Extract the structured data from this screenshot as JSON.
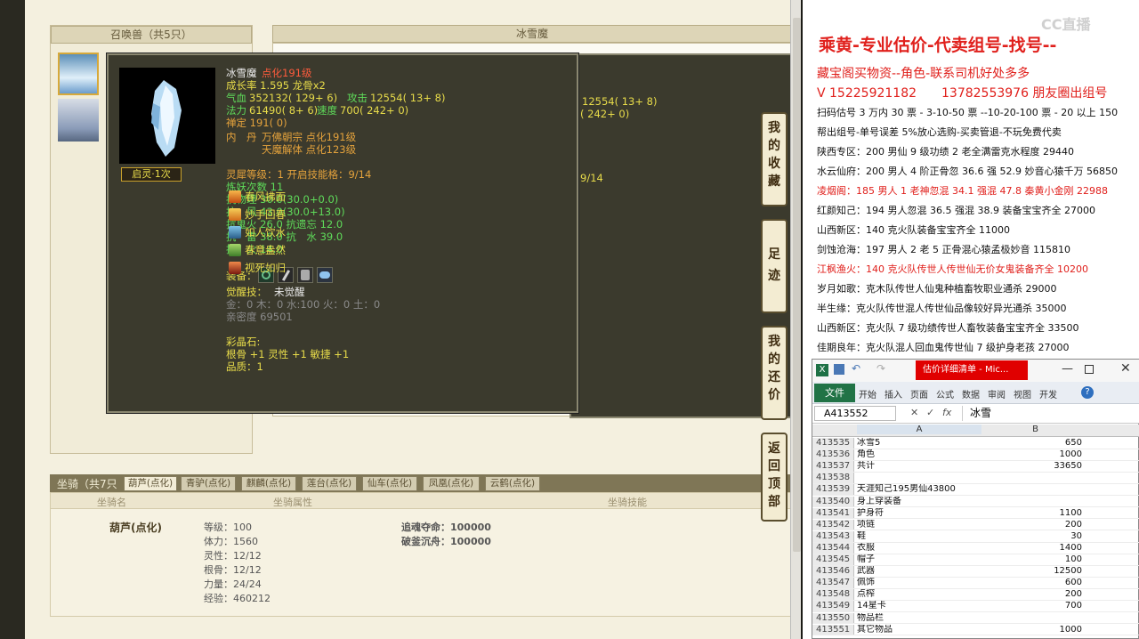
{
  "game": {
    "summon_header": "召唤兽（共5只）",
    "pet_name_header": "冰雪魔",
    "mount_header": "坐骑（共7只",
    "mount_tabs": [
      "葫芦(点化)",
      "青驴(点化)",
      "麒麟(点化)",
      "莲台(点化)",
      "仙车(点化)",
      "凤凰(点化)",
      "云鹤(点化)"
    ],
    "mount_cols": [
      "坐骑名",
      "坐骑属性",
      "坐骑技能"
    ],
    "mount_name": "葫芦(点化)",
    "mount_attrs": [
      "等级：100",
      "体力：1560",
      "灵性：12/12",
      "根骨：12/12",
      "力量：24/24",
      "经验：460212"
    ],
    "mount_skills": [
      "追魂夺命：100000",
      "破釜沉舟：100000"
    ],
    "side_buttons": [
      "我的收藏",
      "足迹",
      "我的还价",
      "返回顶部"
    ],
    "bg_peek": {
      "l1": "12554( 13+ 8)",
      "l2": "( 242+ 0)",
      "l3": "9/14"
    },
    "popup": {
      "name": "冰雪魔",
      "name_suffix": "点化191级",
      "growth": "成长率 1.595 龙骨x2",
      "hp_label": "气血",
      "hp_val": "352132( 129+ 6)",
      "atk_label": "攻击",
      "atk_val": "12554( 13+ 8)",
      "mp_label": "法力",
      "mp_val": "61490( 8+ 6)",
      "spd_label": "速度",
      "spd_val": "700( 242+ 0)",
      "zen": "禅定 191( 0)",
      "inner_label": "内　丹",
      "inner1": "万佛朝宗 点化191级",
      "inner2": "天魔解体 点化123级",
      "awaken_label": "启灵·1次",
      "skills": [
        "春风拂面",
        "妙手回春",
        "如人饮水",
        "春意盎然",
        "视死如归"
      ],
      "spirit": "灵犀等级：1 开启技能格：9/14",
      "refine": "炼妖次数 11",
      "res_phys": "抗物理 30.0(30.0+0.0)",
      "res_wind": "抗　风 43.0(30.0+13.0)",
      "res_ghost": "抗鬼火 26.0 抗遗忘 12.0",
      "res_thunder": "抗　雷 38.0 抗　水 39.0",
      "res_fire": "抗　火 14.0",
      "equip_label": "装备：",
      "awake_skill_label": "觉醒技：",
      "awake_skill_val": "未觉醒",
      "elements": "金：0 木：0 水:100 火：0 土：0",
      "intimacy": "亲密度 69501",
      "gem_label": "彩晶石:",
      "gem_vals": "根骨 +1 灵性 +1 敏捷 +1",
      "quality": "品质：1"
    }
  },
  "right": {
    "title": "乘黄-专业估价-代卖组号-找号--",
    "line2": "藏宝阁买物资--角色-联系司机好处多多",
    "line3": "V 15225921182　　13782553976 朋友圈出组号",
    "lines": [
      {
        "t": "扫码估号 3 万内 30 票 - 3-10-50 票 --10-20-100 票 - 20 以上 150",
        "c": "#111"
      },
      {
        "t": "帮出组号-单号误差 5%放心选购-买卖管退-不玩免费代卖",
        "c": "#111"
      },
      {
        "t": "陕西专区：200 男仙 9 级功绩 2 老全满雷克水程度 29440",
        "c": "#111"
      },
      {
        "t": "水云仙府：200 男人 4 阶正骨忽 36.6 强 52.9 妙音心猿千万 56850",
        "c": "#111"
      },
      {
        "t": "凌烟阁：185 男人 1 老神忽混 34.1 强混 47.8 秦黄小金刚 22988",
        "c": "#e0201c"
      },
      {
        "t": "红颜知己：194 男人忽混 36.5 强混 38.9 装备宝宝齐全 27000",
        "c": "#111"
      },
      {
        "t": "山西新区：140 克火队装备宝宝齐全 11000",
        "c": "#111"
      },
      {
        "t": "剑蚀沧海：197 男人 2 老 5 正骨混心猿孟极妙音 115810",
        "c": "#111"
      },
      {
        "t": "江枫渔火：140 克火队传世人传世仙无价女鬼装备齐全 10200",
        "c": "#e0201c"
      },
      {
        "t": "岁月如歌：克木队传世人仙鬼种植畜牧职业通杀 29000",
        "c": "#111"
      },
      {
        "t": "半生缘：克火队传世混人传世仙品像较好异光通杀 35000",
        "c": "#111"
      },
      {
        "t": "山西新区：克火队 7 级功绩传世人畜牧装备宝宝齐全 33500",
        "c": "#111"
      },
      {
        "t": "佳期良年：克火队混人回血鬼传世仙 7 级护身老孩 27000",
        "c": "#111"
      }
    ],
    "watermark": "CC直播"
  },
  "excel": {
    "window_title": "估价详细清单 - Mic...",
    "file_tab": "文件",
    "ribbon_tabs": [
      "开始",
      "插入",
      "页面",
      "公式",
      "数据",
      "审阅",
      "视图",
      "开发"
    ],
    "name_box": "A413552",
    "formula": "冰雪",
    "col_a": "A",
    "col_b": "B",
    "rows": [
      {
        "n": "413535",
        "a": "冰雪5",
        "b": "650"
      },
      {
        "n": "413536",
        "a": "角色",
        "b": "1000"
      },
      {
        "n": "413537",
        "a": "共计",
        "b": "33650"
      },
      {
        "n": "413538",
        "a": "",
        "b": ""
      },
      {
        "n": "413539",
        "a": "天涯知己195男仙43800",
        "b": ""
      },
      {
        "n": "413540",
        "a": "身上穿装备",
        "b": ""
      },
      {
        "n": "413541",
        "a": "护身符",
        "b": "1100"
      },
      {
        "n": "413542",
        "a": "项链",
        "b": "200"
      },
      {
        "n": "413543",
        "a": "鞋",
        "b": "30"
      },
      {
        "n": "413544",
        "a": "衣服",
        "b": "1400"
      },
      {
        "n": "413545",
        "a": "帽子",
        "b": "100"
      },
      {
        "n": "413546",
        "a": "武器",
        "b": "12500"
      },
      {
        "n": "413547",
        "a": "佩饰",
        "b": "600"
      },
      {
        "n": "413548",
        "a": "点榨",
        "b": "200"
      },
      {
        "n": "413549",
        "a": "14星卡",
        "b": "700"
      },
      {
        "n": "413550",
        "a": "物品栏",
        "b": ""
      },
      {
        "n": "413551",
        "a": "其它物品",
        "b": "1000"
      }
    ]
  }
}
